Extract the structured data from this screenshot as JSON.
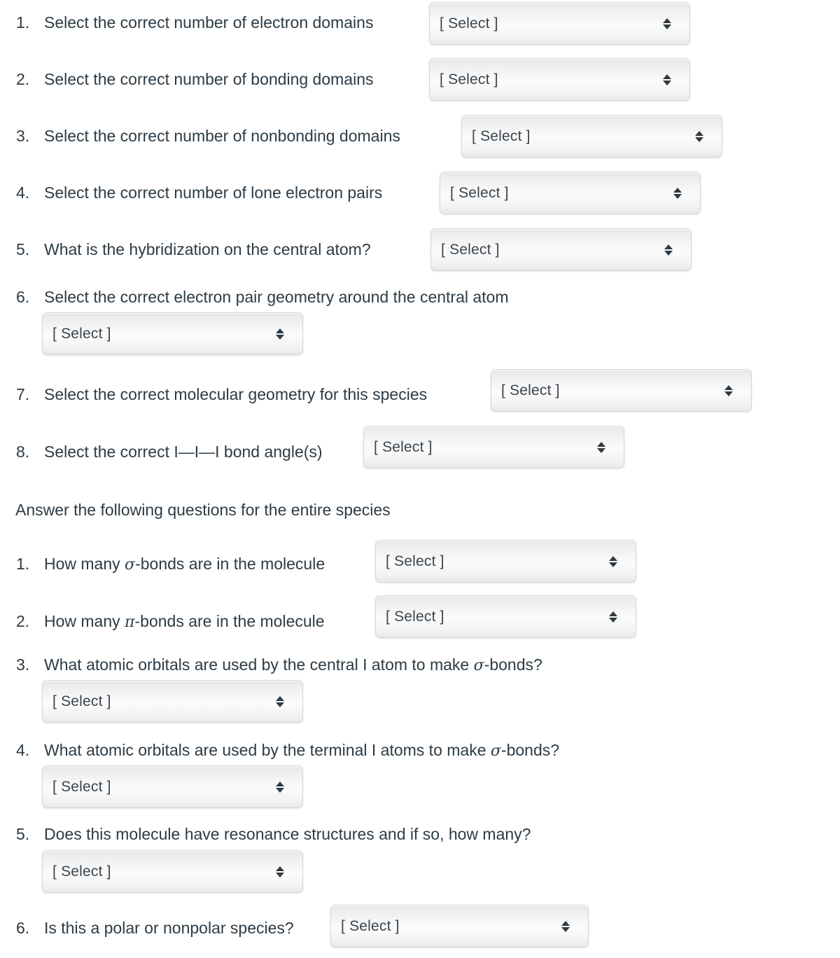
{
  "select_placeholder": "[ Select ]",
  "colors": {
    "text": "#2d3b45",
    "select_text": "#39444e",
    "select_border": "#d6d6d6",
    "background": "#ffffff"
  },
  "part1": {
    "items": [
      {
        "num": "1.",
        "text_before": "Select the correct number of electron domains",
        "greek": "",
        "text_after": "",
        "select": "[ Select ]"
      },
      {
        "num": "2.",
        "text_before": "Select the correct number of bonding domains",
        "greek": "",
        "text_after": "",
        "select": "[ Select ]"
      },
      {
        "num": "3.",
        "text_before": "Select the correct number of nonbonding domains",
        "greek": "",
        "text_after": "",
        "select": "[ Select ]"
      },
      {
        "num": "4.",
        "text_before": "Select the correct number of lone electron pairs",
        "greek": "",
        "text_after": "",
        "select": "[ Select ]"
      },
      {
        "num": "5.",
        "text_before": "What is the hybridization on the central atom?",
        "greek": "",
        "text_after": "",
        "select": "[ Select ]"
      },
      {
        "num": "6.",
        "text_before": "Select the correct electron pair geometry around the central atom",
        "greek": "",
        "text_after": "",
        "select": "[ Select ]"
      },
      {
        "num": "7.",
        "text_before": "Select the correct molecular geometry for this species",
        "greek": "",
        "text_after": "",
        "select": "[ Select ]"
      },
      {
        "num": "8.",
        "text_before": "Select the correct I—I—I bond angle(s)",
        "greek": "",
        "text_after": "",
        "select": "[ Select ]"
      }
    ]
  },
  "section_heading": "Answer the following questions for the entire species",
  "part2": {
    "items": [
      {
        "num": "1.",
        "text_before": "How many ",
        "greek": "σ",
        "text_after": "-bonds are in the molecule",
        "select": "[ Select ]"
      },
      {
        "num": "2.",
        "text_before": "How many ",
        "greek": "π",
        "text_after": "-bonds are in the molecule",
        "select": "[ Select ]"
      },
      {
        "num": "3.",
        "text_before": "What atomic orbitals are used by the central I atom to make ",
        "greek": "σ",
        "text_after": "-bonds?",
        "select": "[ Select ]"
      },
      {
        "num": "4.",
        "text_before": "What atomic orbitals are used by the terminal I atoms to make ",
        "greek": "σ",
        "text_after": "-bonds?",
        "select": "[ Select ]"
      },
      {
        "num": "5.",
        "text_before": "Does this molecule have resonance structures and if so, how many?",
        "greek": "",
        "text_after": "",
        "select": "[ Select ]"
      },
      {
        "num": "6.",
        "text_before": "Is this a polar or nonpolar species?",
        "greek": "",
        "text_after": "",
        "select": "[ Select ]"
      }
    ]
  }
}
